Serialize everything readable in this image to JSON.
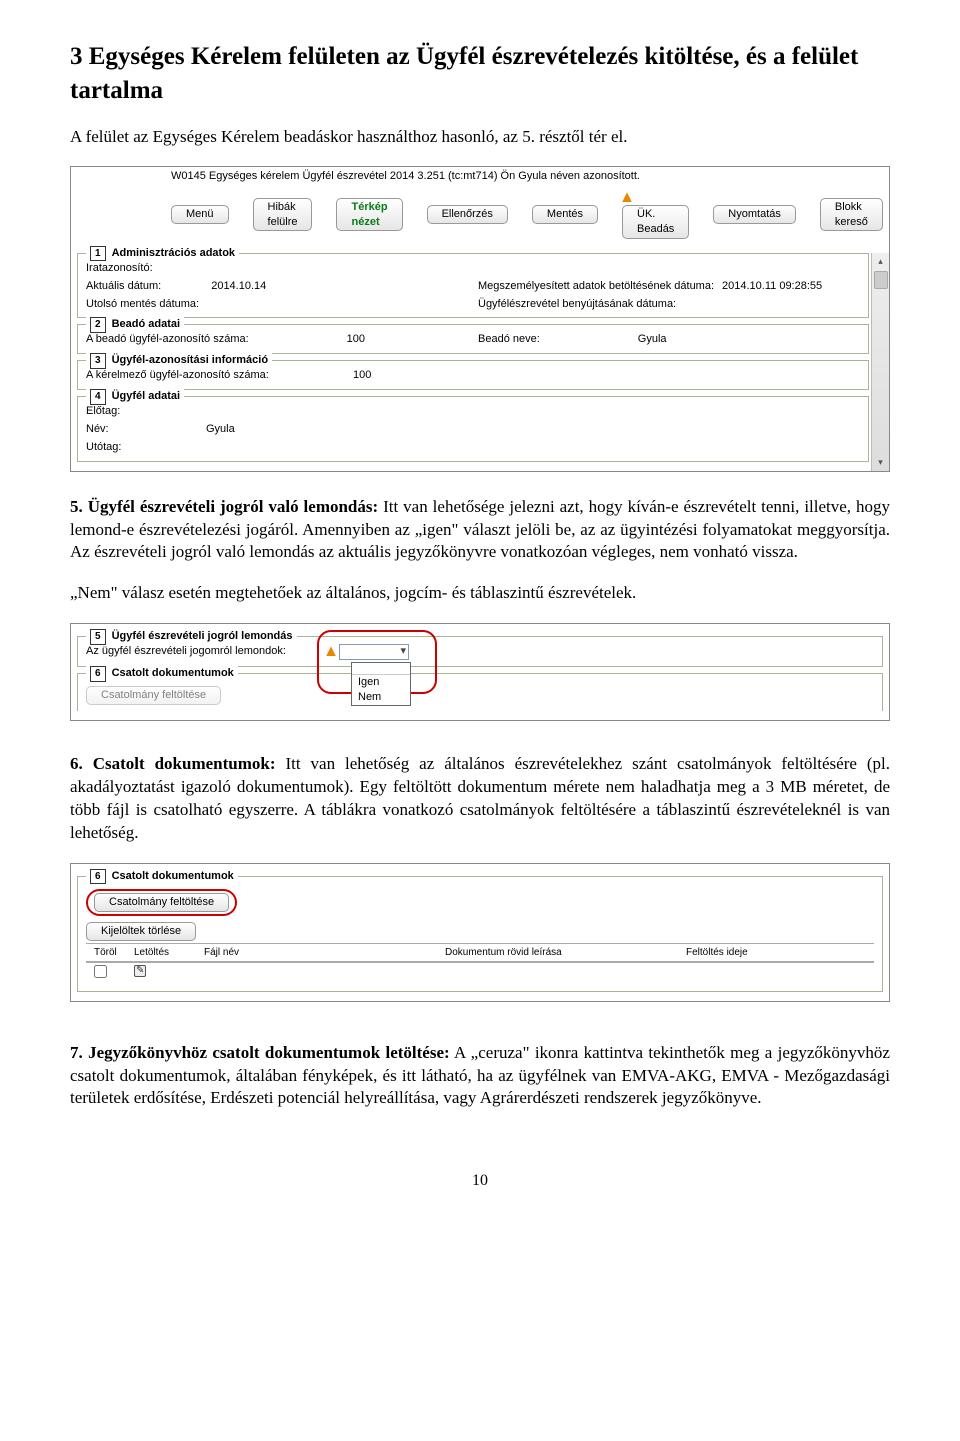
{
  "heading": "3 Egységes Kérelem felületen az Ügyfél észrevételezés kitöltése, és a felület tartalma",
  "para1": "A felület az Egységes Kérelem beadáskor használthoz hasonló, az 5. résztől tér el.",
  "shot1": {
    "title": "W0145 Egységes kérelem Ügyfél észrevétel 2014   3.251 (tc:mt714) Ön           Gyula néven azonosított.",
    "btns": {
      "menu": "Menü",
      "errors": "Hibák felülre",
      "map": "Térkép nézet",
      "check": "Ellenőrzés",
      "save": "Mentés",
      "submit": "ÜK. Beadás",
      "print": "Nyomtatás",
      "block": "Blokk kereső"
    },
    "s1": {
      "legend": "Adminisztrációs adatok",
      "idlabel": "Iratazonosító:",
      "date_label": "Aktuális dátum:",
      "date_val": "2014.10.14",
      "last_save_label": "Utolsó mentés dátuma:",
      "loaded_label": "Megszemélyesített adatok betöltésének dátuma:",
      "loaded_val": "2014.10.11 09:28:55",
      "submit_date_label": "Ügyfélészrevétel benyújtásának dátuma:"
    },
    "s2": {
      "legend": "Beadó adatai",
      "id_label": "A beadó ügyfél-azonosító száma:",
      "id_val": "100",
      "name_label": "Beadó neve:",
      "name_val": "Gyula"
    },
    "s3": {
      "legend": "Ügyfél-azonosítási információ",
      "id_label": "A kérelmező ügyfél-azonosító száma:",
      "id_val": "100"
    },
    "s4": {
      "legend": "Ügyfél adatai",
      "prefix": "Előtag:",
      "name_label": "Név:",
      "name_val": "Gyula",
      "suffix": "Utótag:"
    }
  },
  "para2_prefix": "5. Ügyfél észrevételi jogról való lemondás:",
  "para2": " Itt van lehetősége jelezni azt, hogy kíván-e észrevételt tenni, illetve, hogy lemond-e észrevételezési jogáról. Amennyiben az „igen\" választ jelöli be, az az ügyintézési folyamatokat meggyorsítja. Az észrevételi jogról való lemondás az aktuális jegyzőkönyvre vonatkozóan végleges, nem vonható vissza.",
  "para2b": "„Nem\" válasz esetén megtehetőek az általános, jogcím- és táblaszintű észrevételek.",
  "shot2": {
    "s5_legend": "Ügyfél észrevételi jogról lemondás",
    "s5_label": "Az ügyfél észrevételi jogomról lemondok:",
    "s6_legend": "Csatolt dokumentumok",
    "upload_btn": "Csatolmány feltöltése",
    "opt_yes": "Igen",
    "opt_no": "Nem"
  },
  "para3_prefix": "6. Csatolt dokumentumok:",
  "para3": " Itt van lehetőség az általános észrevételekhez szánt csatolmányok feltöltésére (pl. akadályoztatást igazoló dokumentumok). Egy feltöltött dokumentum mérete nem haladhatja meg a 3 MB méretet, de több fájl is csatolható egyszerre. A táblákra vonatkozó csatolmányok feltöltésére a táblaszintű észrevételeknél is van lehetőség.",
  "shot3": {
    "s6_legend": "Csatolt dokumentumok",
    "upload_btn": "Csatolmány feltöltése",
    "delete_sel": "Kijelöltek törlése",
    "col_del": "Töröl",
    "col_dl": "Letöltés",
    "col_name": "Fájl név",
    "col_desc": "Dokumentum rövid leírása",
    "col_time": "Feltöltés ideje"
  },
  "para4_prefix": "7. Jegyzőkönyvhöz csatolt dokumentumok letöltése:",
  "para4": " A „ceruza\" ikonra kattintva tekinthetők meg a jegyzőkönyvhöz csatolt dokumentumok, általában fényképek, és itt látható, ha az ügyfélnek van EMVA-AKG, EMVA - Mezőgazdasági területek erdősítése, Erdészeti potenciál helyreállítása, vagy Agrárerdészeti rendszerek jegyzőkönyve.",
  "page_number": "10"
}
